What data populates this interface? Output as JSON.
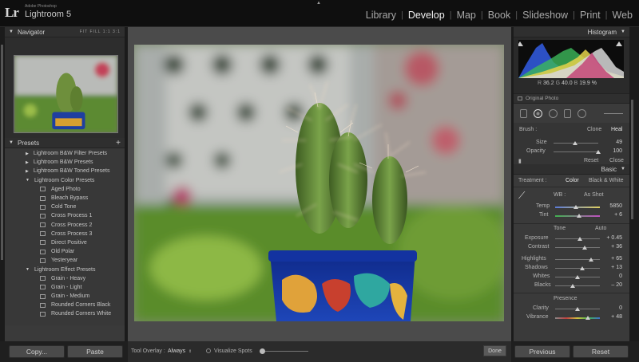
{
  "app": {
    "brand_small": "Adobe Photoshop",
    "brand": "Lightroom 5",
    "logo": "Lr"
  },
  "modules": [
    "Library",
    "Develop",
    "Map",
    "Book",
    "Slideshow",
    "Print",
    "Web"
  ],
  "active_module": "Develop",
  "navigator": {
    "title": "Navigator",
    "options": "FIT  FILL  1:1  3:1"
  },
  "presets": {
    "title": "Presets",
    "rows": [
      {
        "type": "folder",
        "label": "Lightroom B&W Filter Presets",
        "open": false
      },
      {
        "type": "folder",
        "label": "Lightroom B&W Presets",
        "open": false
      },
      {
        "type": "folder",
        "label": "Lightroom B&W Toned Presets",
        "open": false
      },
      {
        "type": "folder",
        "label": "Lightroom Color Presets",
        "open": true
      },
      {
        "type": "item",
        "label": "Aged Photo"
      },
      {
        "type": "item",
        "label": "Bleach Bypass"
      },
      {
        "type": "item",
        "label": "Cold Tone"
      },
      {
        "type": "item",
        "label": "Cross Process 1"
      },
      {
        "type": "item",
        "label": "Cross Process 2"
      },
      {
        "type": "item",
        "label": "Cross Process 3"
      },
      {
        "type": "item",
        "label": "Direct Positive"
      },
      {
        "type": "item",
        "label": "Old Polar"
      },
      {
        "type": "item",
        "label": "Yesteryear"
      },
      {
        "type": "folder",
        "label": "Lightroom Effect Presets",
        "open": true
      },
      {
        "type": "item",
        "label": "Grain - Heavy"
      },
      {
        "type": "item",
        "label": "Grain - Light"
      },
      {
        "type": "item",
        "label": "Grain - Medium"
      },
      {
        "type": "item",
        "label": "Rounded Corners Black"
      },
      {
        "type": "item",
        "label": "Rounded Corners White"
      }
    ]
  },
  "histogram": {
    "title": "Histogram",
    "r": "36.2",
    "g": "40.0",
    "b": "19.9",
    "unit": "%",
    "original_photo": "Original Photo"
  },
  "brush": {
    "label": "Brush :",
    "clone": "Clone",
    "heal": "Heal",
    "size_label": "Size",
    "size_value": "49",
    "size_level": 0.49,
    "opacity_label": "Opacity",
    "opacity_value": "100",
    "opacity_level": 1.0,
    "reset": "Reset",
    "close": "Close"
  },
  "basic": {
    "title": "Basic",
    "treatment_label": "Treatment :",
    "color": "Color",
    "bw": "Black & White",
    "wb_label": "WB :",
    "wb_value": "As Shot",
    "temp_label": "Temp",
    "temp_value": "5850",
    "tint_label": "Tint",
    "tint_value": "+ 6",
    "tone_label": "Tone",
    "auto": "Auto",
    "exposure_label": "Exposure",
    "exposure_value": "+ 0.45",
    "contrast_label": "Contrast",
    "contrast_value": "+ 36",
    "highlights_label": "Highlights",
    "highlights_value": "+ 65",
    "shadows_label": "Shadows",
    "shadows_value": "+ 13",
    "whites_label": "Whites",
    "whites_value": "0",
    "blacks_label": "Blacks",
    "blacks_value": "– 20",
    "presence_label": "Presence",
    "clarity_label": "Clarity",
    "clarity_value": "0",
    "vibrance_label": "Vibrance",
    "vibrance_value": "+ 48"
  },
  "bottom": {
    "copy": "Copy...",
    "paste": "Paste",
    "tool_overlay_label": "Tool Overlay :",
    "tool_overlay_value": "Always",
    "visualize_spots": "Visualize Spots",
    "done": "Done",
    "previous": "Previous",
    "reset": "Reset"
  },
  "colors": {
    "panel": "#3a3a3a",
    "header": "#2f2f2f",
    "topbar": "#0f0f0f",
    "pot_blue": "#1f3fa0",
    "cactus_green": "#5e8a2c"
  }
}
